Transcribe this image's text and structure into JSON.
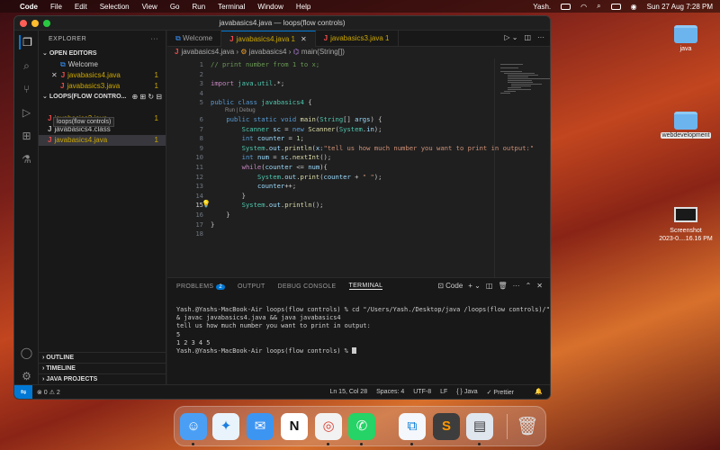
{
  "menubar": {
    "apple": "",
    "items": [
      "Code",
      "File",
      "Edit",
      "Selection",
      "View",
      "Go",
      "Run",
      "Terminal",
      "Window",
      "Help"
    ],
    "user": "Yash.",
    "datetime": "Sun 27 Aug  7:28 PM"
  },
  "window": {
    "title": "javabasics4.java — loops(flow controls)"
  },
  "explorer": {
    "header": "EXPLORER",
    "more": "···",
    "open_editors": "OPEN EDITORS",
    "open": [
      {
        "name": "Welcome",
        "count": ""
      },
      {
        "close": "✕",
        "name": "javabasics4.java",
        "count": "1"
      },
      {
        "name": "javabasics3.java",
        "count": "1"
      }
    ],
    "folder": "LOOPS(FLOW CONTRO...",
    "tooltip": "loops(flow controls)",
    "files": [
      {
        "name": "javabasics3.java",
        "count": "1"
      },
      {
        "name": "javabasics4.class",
        "count": ""
      },
      {
        "name": "javabasics4.java",
        "count": "1"
      }
    ],
    "outline": "OUTLINE",
    "timeline": "TIMELINE",
    "java_projects": "JAVA PROJECTS"
  },
  "tabs": [
    {
      "label": "Welcome"
    },
    {
      "label": "javabasics4.java 1",
      "close": "✕"
    },
    {
      "label": "javabasics3.java 1"
    }
  ],
  "breadcrumb": {
    "file": "javabasics4.java",
    "klass": "javabasics4",
    "method": "main(String[])"
  },
  "codelens": "Run | Debug",
  "code": [
    {
      "n": "1",
      "html": "<span class=\"cm\">// print number from 1 to x;</span>"
    },
    {
      "n": "2",
      "html": ""
    },
    {
      "n": "3",
      "html": "<span class=\"pk\">import</span> <span class=\"ty\">java</span>.<span class=\"ty\">util</span>.*;"
    },
    {
      "n": "4",
      "html": ""
    },
    {
      "n": "5",
      "html": "<span class=\"kw\">public</span> <span class=\"kw\">class</span> <span class=\"ty\">javabasics4</span> {"
    },
    {
      "n": "6",
      "html": "    <span class=\"kw\">public</span> <span class=\"kw\">static</span> <span class=\"kw\">void</span> <span class=\"fn\">main</span>(<span class=\"ty\">String</span>[] <span class=\"vr\">args</span>) {"
    },
    {
      "n": "7",
      "html": "        <span class=\"ty\">Scanner</span> <span class=\"vr\">sc</span> = <span class=\"kw\">new</span> <span class=\"fn\">Scanner</span>(<span class=\"ty\">System</span>.<span class=\"vr\">in</span>);"
    },
    {
      "n": "8",
      "html": "        <span class=\"kw\">int</span> <span class=\"vr\">counter</span> = <span class=\"nm\">1</span>;"
    },
    {
      "n": "9",
      "html": "        <span class=\"ty\">System</span>.<span class=\"vr\">out</span>.<span class=\"fn\">println</span>(<span class=\"vr\">x:</span><span class=\"st\">\"tell us how much number you want to print in output:\"</span>"
    },
    {
      "n": "10",
      "html": "        <span class=\"kw\">int</span> <span class=\"vr\">num</span> = <span class=\"vr\">sc</span>.<span class=\"fn\">nextInt</span>();"
    },
    {
      "n": "11",
      "html": "        <span class=\"pk\">while</span>(<span class=\"vr\">counter</span> &lt;= <span class=\"vr\">num</span>){"
    },
    {
      "n": "12",
      "html": "            <span class=\"ty\">System</span>.<span class=\"vr\">out</span>.<span class=\"fn\">print</span>(<span class=\"vr\">counter</span> + <span class=\"st\">\" \"</span>);"
    },
    {
      "n": "13",
      "html": "            <span class=\"vr\">counter</span>++;"
    },
    {
      "n": "14",
      "html": "        }"
    },
    {
      "n": "15",
      "html": "        <span class=\"ty\">System</span>.<span class=\"vr\">out</span>.<span class=\"fn\">println</span>();"
    },
    {
      "n": "16",
      "html": "    }"
    },
    {
      "n": "17",
      "html": "}"
    },
    {
      "n": "18",
      "html": ""
    }
  ],
  "panel": {
    "tabs": [
      "PROBLEMS",
      "OUTPUT",
      "DEBUG CONSOLE",
      "TERMINAL"
    ],
    "problems_count": "2",
    "shell": "Code",
    "terminal": [
      "Yash.@Yashs-MacBook-Air loops(flow controls) % cd \"/Users/Yash./Desktop/java /loops(flow controls)/\" &",
      "& javac javabasics4.java && java javabasics4",
      "tell us how much number you want to print in output:",
      "5",
      "1 2 3 4 5",
      "Yash.@Yashs-MacBook-Air loops(flow controls) % "
    ]
  },
  "status": {
    "problems": "⊗ 0 ⚠ 2",
    "position": "Ln 15, Col 28",
    "spaces": "Spaces: 4",
    "encoding": "UTF-8",
    "eol": "LF",
    "language": "{ } Java",
    "prettier": "✓ Prettier"
  },
  "desktop": [
    {
      "label": "java"
    },
    {
      "label": "webdevelopment"
    },
    {
      "label": "Screenshot\n2023-0....16.16 PM"
    }
  ],
  "dock": [
    "Finder",
    "Safari",
    "Mail",
    "Notion",
    "Chrome",
    "WhatsApp",
    "VS Code",
    "Sublime Text",
    "Preview",
    "Trash"
  ],
  "colors": {
    "accent": "#0078d4",
    "error": "#f14c4c",
    "warning": "#cca700"
  }
}
